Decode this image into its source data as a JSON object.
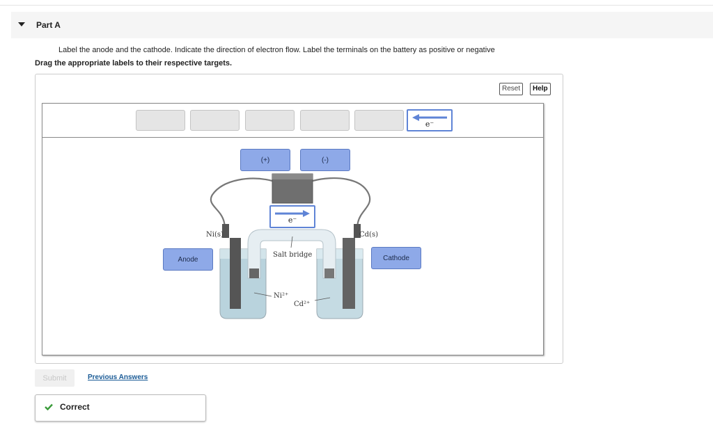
{
  "part": {
    "title": "Part A"
  },
  "question": {
    "instruction": "Label the anode and the cathode. Indicate the direction of electron flow. Label the terminals on the battery as positive or negative",
    "drag_instruction": "Drag the appropriate labels to their respective targets."
  },
  "toolbar": {
    "reset_label": "Reset",
    "help_label": "Help"
  },
  "labels": {
    "positive": "(+)",
    "negative": "(-)",
    "anode": "Anode",
    "cathode": "Cathode",
    "electron": "e⁻"
  },
  "figure": {
    "left_electrode": "Ni(s)",
    "right_electrode": "Cd(s)",
    "salt_bridge": "Salt bridge",
    "left_ion": "Ni²⁺",
    "right_ion": "Cd²⁺"
  },
  "actions": {
    "submit_label": "Submit",
    "previous_answers_label": "Previous Answers"
  },
  "feedback": {
    "status": "Correct"
  },
  "colors": {
    "label_fill": "#8ea9e8",
    "arrow": "#5f84d6",
    "check": "#3a9b3a",
    "link": "#1a5b96"
  }
}
